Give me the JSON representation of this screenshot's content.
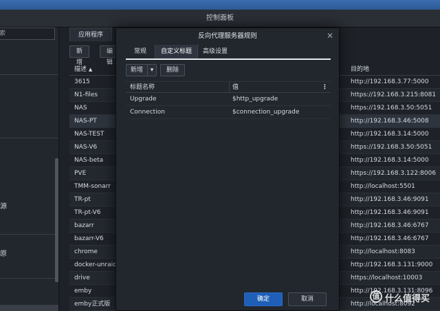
{
  "window": {
    "title": "控制面板"
  },
  "sidebar": {
    "search_text": "索",
    "items": [
      {
        "label": "源"
      },
      {
        "label": "原"
      }
    ]
  },
  "main": {
    "tab_label": "应用程序",
    "toolbar": {
      "add_label": "新增",
      "edit_label": "编辑"
    },
    "columns": {
      "description": "描述",
      "sort_indicator": "▲",
      "destination": "目的地"
    },
    "rows": [
      {
        "desc": "3615",
        "dest": "http://192.168.3.77:5000"
      },
      {
        "desc": "N1-files",
        "dest": "https://192.168.3.215:8081"
      },
      {
        "desc": "NAS",
        "dest": "https://192.168.3.50:5051"
      },
      {
        "desc": "NAS-PT",
        "dest": "http://192.168.3.46:5008"
      },
      {
        "desc": "NAS-TEST",
        "dest": "http://192.168.3.14:5000"
      },
      {
        "desc": "NAS-V6",
        "dest": "https://192.168.3.50:5051"
      },
      {
        "desc": "NAS-beta",
        "dest": "http://192.168.3.14:5000"
      },
      {
        "desc": "PVE",
        "dest": "https://192.168.3.122:8006"
      },
      {
        "desc": "TMM-sonarr",
        "dest": "http://localhost:5501"
      },
      {
        "desc": "TR-pt",
        "dest": "http://192.168.3.46:9091"
      },
      {
        "desc": "TR-pt-V6",
        "dest": "http://192.168.3.46:9091"
      },
      {
        "desc": "bazarr",
        "dest": "http://192.168.3.46:6767"
      },
      {
        "desc": "bazarr-V6",
        "dest": "http://192.168.3.46:6767"
      },
      {
        "desc": "chrome",
        "dest": "http://localhost:8083"
      },
      {
        "desc": "docker-unraid",
        "dest": "http://192.168.3.131:9000"
      },
      {
        "desc": "drive",
        "dest": "https://localhost:10003"
      },
      {
        "desc": "emby",
        "dest": "http://192.168.3.131:8096"
      },
      {
        "desc": "emby正式版",
        "dest": "http://localhost:8092"
      }
    ]
  },
  "dialog": {
    "title": "反向代理服务器规则",
    "close_glyph": "✕",
    "tabs": [
      {
        "label": "常规"
      },
      {
        "label": "自定义标题"
      },
      {
        "label": "高级设置"
      }
    ],
    "toolbar": {
      "add_label": "新增",
      "dropdown_glyph": "▾",
      "delete_label": "删除"
    },
    "headers_table": {
      "col_name": "标题名称",
      "col_value": "值",
      "menu_glyph": "⋮",
      "rows": [
        {
          "name": "Upgrade",
          "value": "$http_upgrade"
        },
        {
          "name": "Connection",
          "value": "$connection_upgrade"
        }
      ]
    },
    "footer": {
      "ok_label": "确定",
      "cancel_label": "取消"
    }
  },
  "watermark": {
    "logo_glyph": "值",
    "text": "什么值得买"
  }
}
